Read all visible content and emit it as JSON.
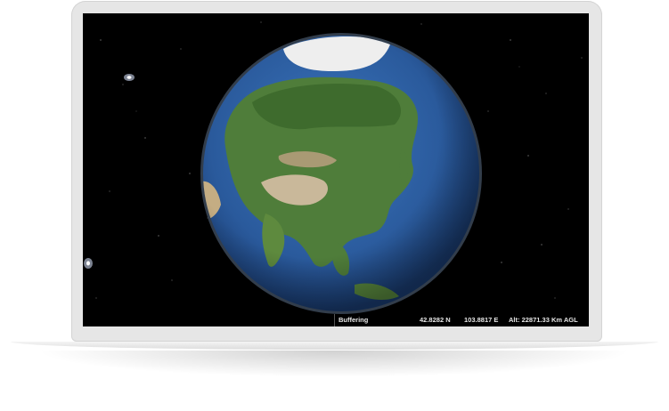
{
  "viewer": {
    "status": {
      "buffering": "Buffering",
      "latitude": "42.8282 N",
      "longitude": "103.8817 E",
      "altitude": "Alt: 22871.33 Km AGL"
    }
  },
  "colors": {
    "space": "#000000",
    "ocean": "#2f63a8",
    "land": "#4f7d3a",
    "ice": "#f2f2f2",
    "device_frame": "#e6e6e6"
  },
  "icons": [
    "globe-icon",
    "star-icon"
  ]
}
